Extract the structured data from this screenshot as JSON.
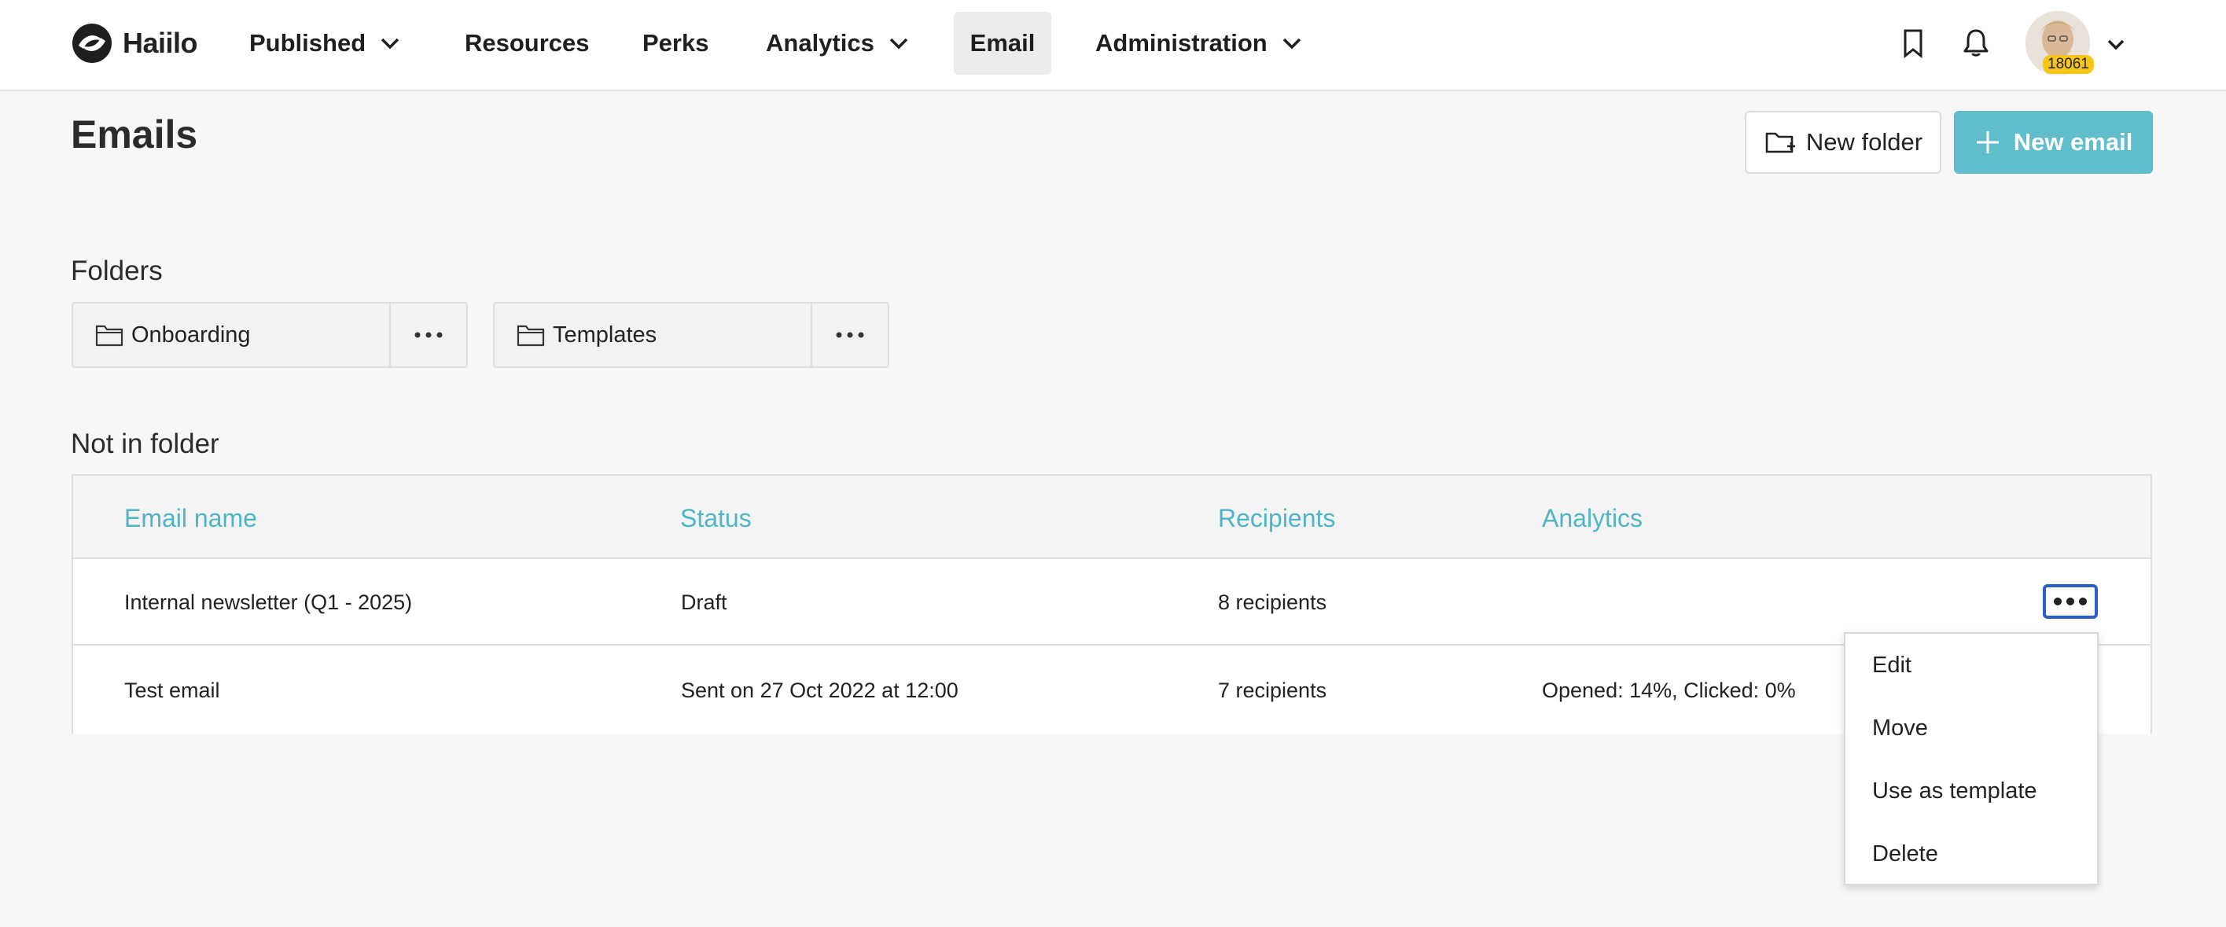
{
  "topbar": {
    "logo_text": "Haiilo",
    "nav": [
      {
        "label": "Published",
        "has_dropdown": true
      },
      {
        "label": "Resources",
        "has_dropdown": false
      },
      {
        "label": "Perks",
        "has_dropdown": false
      },
      {
        "label": "Analytics",
        "has_dropdown": true
      },
      {
        "label": "Email",
        "has_dropdown": false,
        "active": true
      },
      {
        "label": "Administration",
        "has_dropdown": true
      }
    ],
    "icons": [
      "bookmark-icon",
      "bell-icon"
    ],
    "avatar_badge": "18061"
  },
  "page": {
    "title": "Emails",
    "new_folder_label": "New folder",
    "new_email_label": "New email"
  },
  "folders": {
    "label": "Folders",
    "items": [
      {
        "name": "Onboarding"
      },
      {
        "name": "Templates"
      }
    ]
  },
  "not_in_folder": {
    "label": "Not in folder",
    "columns": [
      "Email name",
      "Status",
      "Recipients",
      "Analytics"
    ],
    "rows": [
      {
        "name": "Internal newsletter (Q1 - 2025)",
        "status": "Draft",
        "recipients": "8 recipients",
        "analytics": ""
      },
      {
        "name": "Test email",
        "status": "Sent on 27 Oct 2022 at 12:00",
        "recipients": "7 recipients",
        "analytics": "Opened: 14%, Clicked: 0%"
      }
    ]
  },
  "row_menu": {
    "items": [
      "Edit",
      "Move",
      "Use as template",
      "Delete"
    ]
  },
  "colors": {
    "accent": "#5fbdcc",
    "header_text": "#4fb5c6",
    "focus_ring": "#2b5fc8"
  }
}
